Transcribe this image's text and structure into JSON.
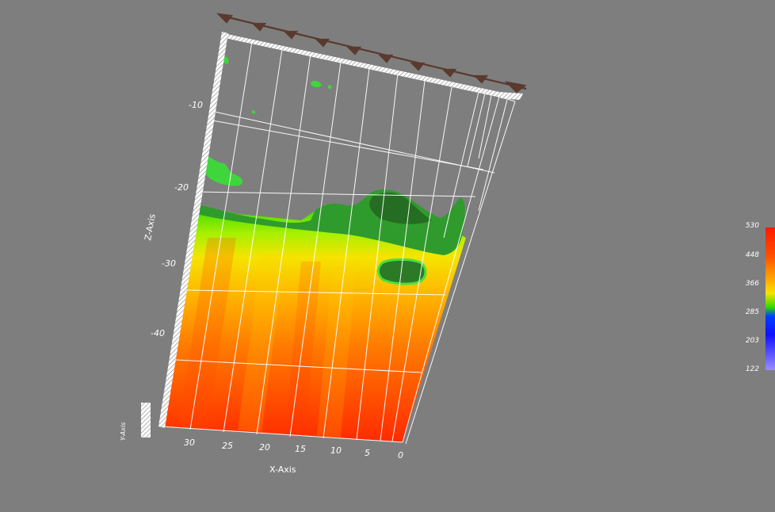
{
  "viewer": {
    "x_axis_title": "X-Axis",
    "z_axis_title": "Z-Axis",
    "y_axis_title": "Y-Axis",
    "x_ticks": [
      "30",
      "25",
      "20",
      "15",
      "10",
      "5",
      "0"
    ],
    "z_ticks": [
      "-10",
      "-20",
      "-30",
      "-40"
    ]
  },
  "legend": {
    "labels": [
      "530",
      "448",
      "366",
      "285",
      "203",
      "122"
    ],
    "colors": {
      "high": "#ff1a00",
      "orange": "#ff7a00",
      "yellow": "#f5e400",
      "green": "#2fd800",
      "blue": "#1010ff",
      "low": "#9a8cff"
    }
  },
  "colors": {
    "background": "#7e7e7e",
    "surface_green": "#2c8c2a",
    "surface_green_light": "#3fd63c",
    "frame_arrows": "#5a3a2e"
  }
}
